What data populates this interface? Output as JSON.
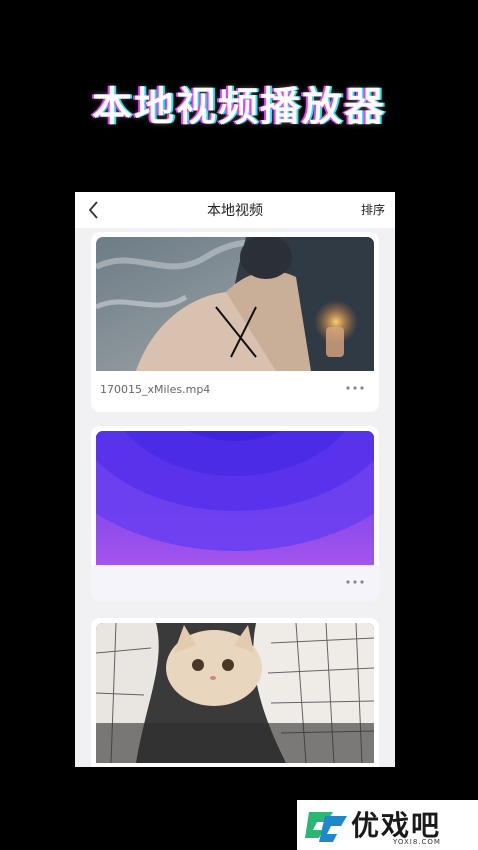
{
  "promo": {
    "title": "本地视频播放器"
  },
  "app": {
    "header": {
      "title": "本地视频",
      "sort_label": "排序"
    },
    "videos": [
      {
        "file_name": "170015_xMiles.mp4"
      },
      {
        "file_name": ""
      },
      {
        "file_name": ""
      }
    ]
  },
  "watermark": {
    "name": "优戏吧",
    "domain": "YOXI8.COM"
  },
  "colors": {
    "background": "#000000",
    "screen_bg": "#f1f1f3",
    "accent_purple": "#7b3df2"
  }
}
